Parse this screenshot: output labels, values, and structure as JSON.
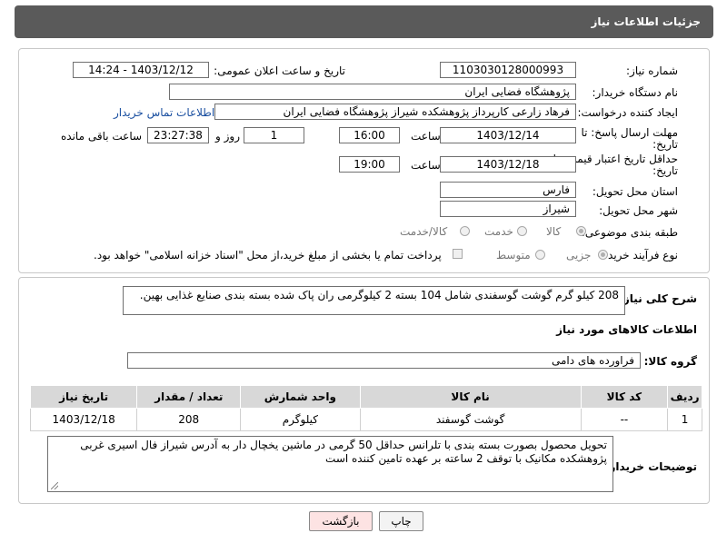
{
  "header": {
    "title": "جزئیات اطلاعات نیاز"
  },
  "form": {
    "need_number": {
      "label": "شماره نیاز:",
      "value": "1103030128000993"
    },
    "announce_datetime": {
      "label": "تاریخ و ساعت اعلان عمومی:",
      "value": "1403/12/12 - 14:24"
    },
    "buyer_org": {
      "label": "نام دستگاه خریدار:",
      "value": "پژوهشگاه فضایی ایران"
    },
    "requester": {
      "label": "ایجاد کننده درخواست:",
      "value": "فرهاد زارعی کارپرداز پژوهشکده شیراز پژوهشگاه فضایی ایران",
      "contact_link": "اطلاعات تماس خریدار"
    },
    "reply_deadline": {
      "label_line1": "مهلت ارسال پاسخ: تا",
      "label_line2": "تاریخ:",
      "date": "1403/12/14",
      "time_label": "ساعت",
      "time": "16:00",
      "days": "1",
      "days_label": "روز و",
      "remaining": "23:27:38",
      "remaining_label": "ساعت باقی مانده"
    },
    "price_validity": {
      "label_line1": "حداقل تاریخ اعتبار قیمت: تا",
      "label_line2": "تاریخ:",
      "date": "1403/12/18",
      "time_label": "ساعت",
      "time": "19:00"
    },
    "province": {
      "label": "استان محل تحویل:",
      "value": "فارس"
    },
    "city": {
      "label": "شهر محل تحویل:",
      "value": "شیراز"
    },
    "category": {
      "label": "طبقه بندی موضوعی:",
      "options": [
        "کالا",
        "خدمت",
        "کالا/خدمت"
      ]
    },
    "purchase_process": {
      "label": "نوع فرآیند خرید :",
      "options": [
        "جزیی",
        "متوسط"
      ],
      "payment_note": "پرداخت تمام یا بخشی از مبلغ خرید،از محل \"اسناد خزانه اسلامی\" خواهد بود."
    }
  },
  "details": {
    "description_label": "شرح کلی نیاز:",
    "description": "208 کیلو گرم گوشت گوسفندی شامل 104 بسته 2 کیلوگرمی ران پاک شده بسته بندی صنایع غذایی بهین.",
    "goods_info_title": "اطلاعات کالاهای مورد نیاز",
    "goods_group_label": "گروه کالا:",
    "goods_group": "فراورده های دامی",
    "table": {
      "headers": [
        "ردیف",
        "کد کالا",
        "نام کالا",
        "واحد شمارش",
        "تعداد / مقدار",
        "تاریخ نیاز"
      ],
      "rows": [
        [
          "1",
          "--",
          "گوشت گوسفند",
          "کیلوگرم",
          "208",
          "1403/12/18"
        ]
      ]
    },
    "buyer_notes_label": "توضیحات خریدار:",
    "buyer_notes": "تحویل محصول بصورت بسته بندی با تلرانس حداقل  50 گرمی در ماشین یخچال دار به آدرس شیراز فال اسیری غربی پژوهشکده مکانیک با توقف 2 ساعته بر عهده تامین کننده است"
  },
  "buttons": {
    "print": "چاپ",
    "back": "بازگشت"
  }
}
